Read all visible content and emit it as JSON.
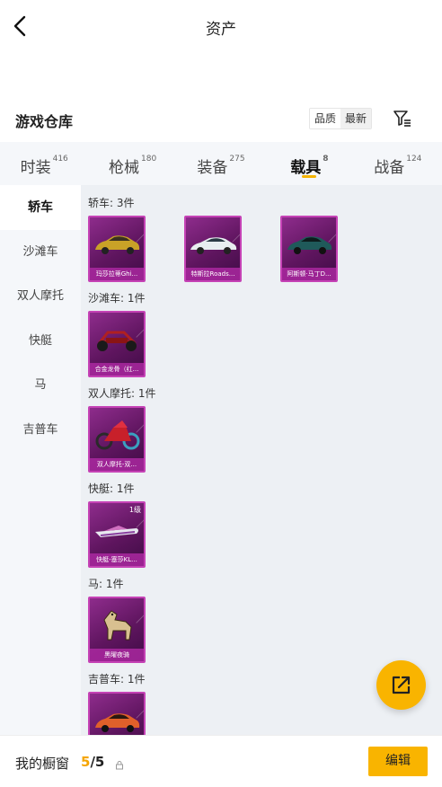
{
  "nav": {
    "title": "资产"
  },
  "warehouse": {
    "title": "游戏仓库",
    "sort_options": [
      "品质",
      "最新"
    ]
  },
  "tabs": [
    {
      "label": "时装",
      "count": "416"
    },
    {
      "label": "枪械",
      "count": "180"
    },
    {
      "label": "装备",
      "count": "275"
    },
    {
      "label": "载具",
      "count": "8"
    },
    {
      "label": "战备",
      "count": "124"
    }
  ],
  "active_tab": "载具",
  "sidebar": {
    "items": [
      "轿车",
      "沙滩车",
      "双人摩托",
      "快艇",
      "马",
      "吉普车"
    ],
    "active": "轿车"
  },
  "sections": [
    {
      "label": "轿车: 3件",
      "items": [
        {
          "name": "玛莎拉蒂Ghi...",
          "icon": "gold-sedan-icon"
        },
        {
          "name": "特斯拉Roads...",
          "icon": "white-roadster-icon"
        },
        {
          "name": "阿斯顿·马丁D...",
          "icon": "teal-sports-car-icon"
        }
      ]
    },
    {
      "label": "沙滩车: 1件",
      "items": [
        {
          "name": "合金龙骨（红...",
          "icon": "buggy-icon"
        }
      ]
    },
    {
      "label": "双人摩托: 1件",
      "items": [
        {
          "name": "双人摩托-双...",
          "icon": "motorcycle-icon"
        }
      ]
    },
    {
      "label": "快艇: 1件",
      "items": [
        {
          "name": "快艇-塞莎KL...",
          "icon": "speedboat-icon",
          "level": "1级"
        }
      ]
    },
    {
      "label": "马: 1件",
      "items": [
        {
          "name": "黑曜夜骑",
          "icon": "horse-icon"
        }
      ]
    },
    {
      "label": "吉普车: 1件",
      "items": [
        {
          "name": "",
          "icon": "orange-car-icon"
        }
      ]
    }
  ],
  "bottom": {
    "label": "我的橱窗",
    "count_current": "5",
    "count_sep_total": "/5",
    "edit_label": "编辑"
  },
  "colors": {
    "accent": "#f9b400",
    "card_purple": "#6a1a6a",
    "card_border": "#c542b5"
  }
}
